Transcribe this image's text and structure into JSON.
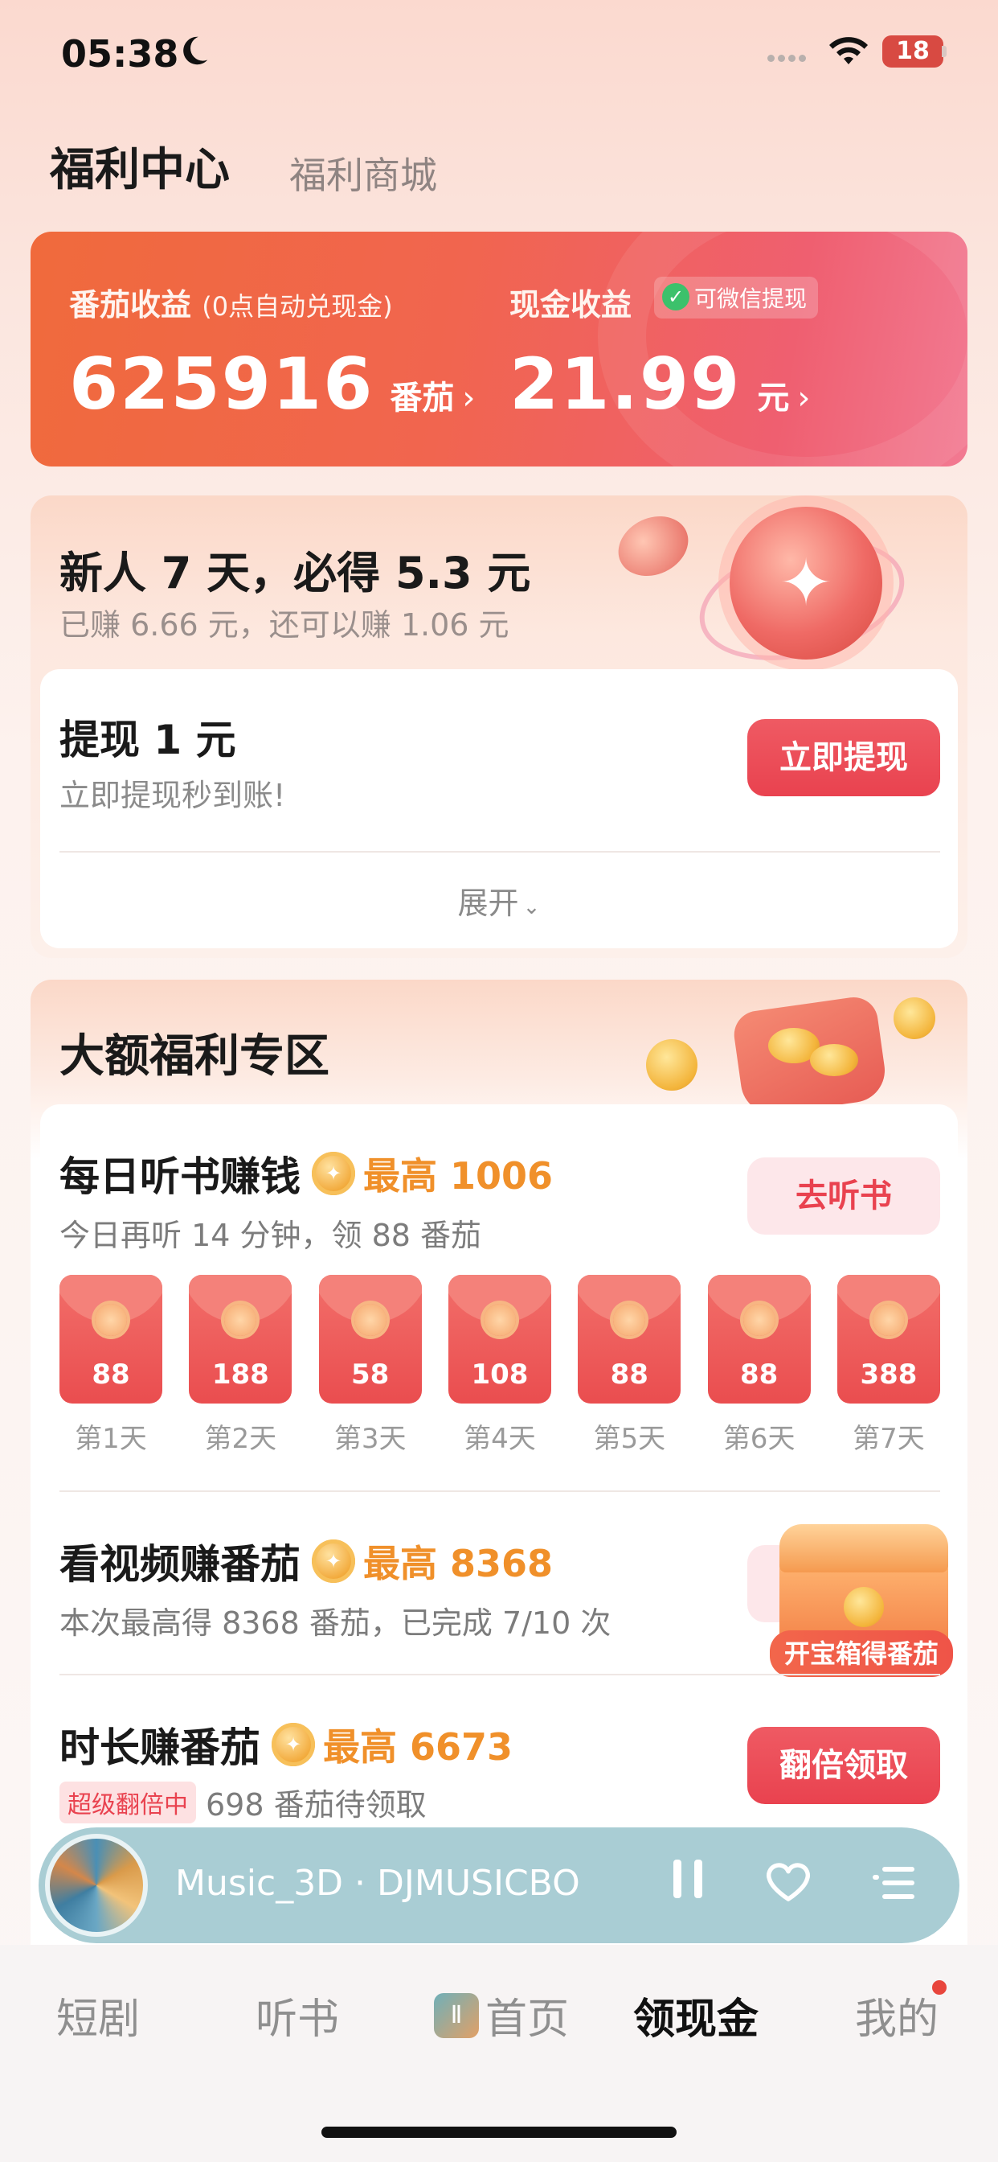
{
  "status_bar": {
    "time": "05:38",
    "battery": "18"
  },
  "top_tabs": {
    "main": "福利中心",
    "secondary": "福利商城"
  },
  "earnings": {
    "tomato_label": "番茄收益",
    "tomato_note": "(0点自动兑现金)",
    "tomato_value": "625916",
    "tomato_unit": "番茄",
    "cash_label": "现金收益",
    "wechat_badge": "可微信提现",
    "cash_value": "21.99",
    "cash_unit": "元",
    "accent_color": "#f1654f"
  },
  "newbie": {
    "title": "新人 7 天，必得 5.3 元",
    "subtitle": "已赚 6.66 元，还可以赚 1.06 元",
    "withdraw_title": "提现 1 元",
    "withdraw_sub": "立即提现秒到账!",
    "withdraw_button": "立即提现",
    "expand_label": "展开"
  },
  "welfare": {
    "title": "大额福利专区",
    "listen": {
      "title": "每日听书赚钱",
      "max": "最高 1006",
      "desc": "今日再听 14 分钟，领 88 番茄",
      "button": "去听书"
    },
    "days": [
      {
        "amount": "88",
        "label": "第1天"
      },
      {
        "amount": "188",
        "label": "第2天"
      },
      {
        "amount": "58",
        "label": "第3天"
      },
      {
        "amount": "108",
        "label": "第4天"
      },
      {
        "amount": "88",
        "label": "第5天"
      },
      {
        "amount": "88",
        "label": "第6天"
      },
      {
        "amount": "388",
        "label": "第7天"
      }
    ],
    "video": {
      "title": "看视频赚番茄",
      "max": "最高 8368",
      "desc": "本次最高得 8368 番茄，已完成 7/10 次",
      "chest_label": "开宝箱得番茄"
    },
    "duration": {
      "title": "时长赚番茄",
      "max": "最高 6673",
      "tag": "超级翻倍中",
      "desc": "698 番茄待领取",
      "button": "翻倍领取"
    }
  },
  "player": {
    "track": "Music_3D · DJMUSICBO"
  },
  "tabbar": {
    "items": [
      "短剧",
      "听书",
      "首页",
      "领现金",
      "我的"
    ],
    "active": "领现金"
  }
}
